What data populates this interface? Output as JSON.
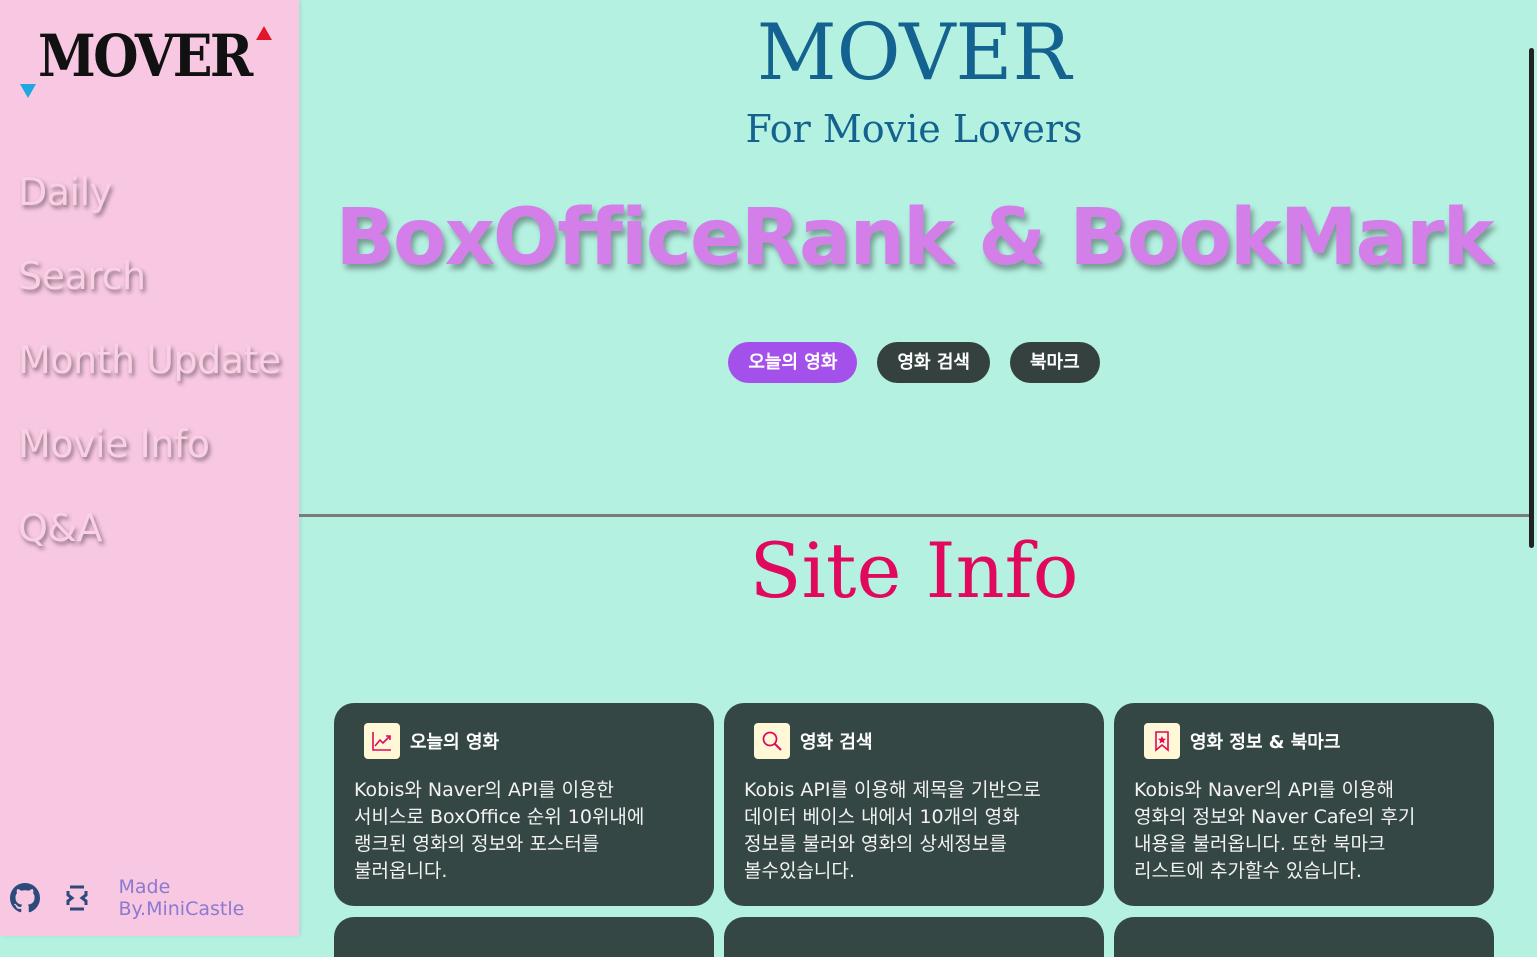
{
  "sidebar": {
    "logo_text": "MOVER",
    "nav": [
      "Daily",
      "Search",
      "Month Update",
      "Movie Info",
      "Q&A"
    ],
    "footer": {
      "made_by": "Made By.MiniCastle"
    }
  },
  "hero": {
    "title": "MOVER",
    "subtitle": "For Movie Lovers",
    "banner": "BoxOfficeRank & BookMark",
    "buttons": [
      "오늘의 영화",
      "영화 검색",
      "북마크"
    ]
  },
  "site_info": {
    "title": "Site Info",
    "cards": [
      {
        "icon": "trending-up-icon",
        "title": "오늘의 영화",
        "body": [
          "Kobis와 Naver의 API를 이용한",
          "서비스로 BoxOffice 순위 10위내에",
          "랭크된 영화의 정보와 포스터를",
          "불러옵니다."
        ]
      },
      {
        "icon": "search-icon",
        "title": "영화 검색",
        "body": [
          "Kobis API를 이용해 제목을 기반으로",
          "데이터 베이스 내에서 10개의 영화",
          "정보를 불러와 영화의 상세정보를",
          "볼수있습니다."
        ]
      },
      {
        "icon": "bookmark-icon",
        "title": "영화 정보 & 북마크",
        "body": [
          "Kobis와 Naver의 API를 이용해",
          "영화의 정보와 Naver Cafe의 후기",
          "내용을 불러옵니다. 또한 북마크",
          "리스트에 추가할수 있습니다."
        ]
      }
    ]
  },
  "colors": {
    "sidebar_bg": "#f8c7e2",
    "main_bg": "#b5f1e1",
    "accent_purple": "#a450ea",
    "title_blue": "#14628f",
    "site_info_red": "#e0095e",
    "card_bg": "#354744"
  }
}
